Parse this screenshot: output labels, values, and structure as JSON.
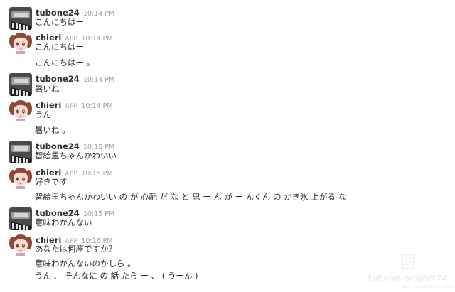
{
  "messages": [
    {
      "user": "tubone24",
      "time": "10:14 PM",
      "lines": [
        "こんにちはー"
      ]
    },
    {
      "user": "chieri",
      "badge": "APP",
      "time": "10:14 PM",
      "lines": [
        "こんにちはー",
        "こんにちはー 。"
      ]
    },
    {
      "user": "tubone24",
      "time": "10:14 PM",
      "lines": [
        "暑いね"
      ]
    },
    {
      "user": "chieri",
      "badge": "APP",
      "time": "10:14 PM",
      "lines": [
        "うん",
        "暑いね 。"
      ]
    },
    {
      "user": "tubone24",
      "time": "10:15 PM",
      "lines": [
        "智絵里ちゃんかわいい"
      ]
    },
    {
      "user": "chieri",
      "badge": "APP",
      "time": "10:15 PM",
      "lines": [
        "好きです",
        "智絵里ちゃんかわいい の が 心配 だ な と 思 ー ん が ー んくん の かき氷 上がる な"
      ]
    },
    {
      "user": "tubone24",
      "time": "10:15 PM",
      "lines": [
        "意味わかんない"
      ]
    },
    {
      "user": "chieri",
      "badge": "APP",
      "time": "10:16 PM",
      "lines": [
        "あなたは何座ですか？",
        "意味わかんないのかしら 。",
        "うん 、 そんなに の 話 たら ー 、 ( うーん )"
      ]
    }
  ],
  "watermark": {
    "title": "tubone-project24",
    "subtitle": "By A project24 Service Plans"
  }
}
